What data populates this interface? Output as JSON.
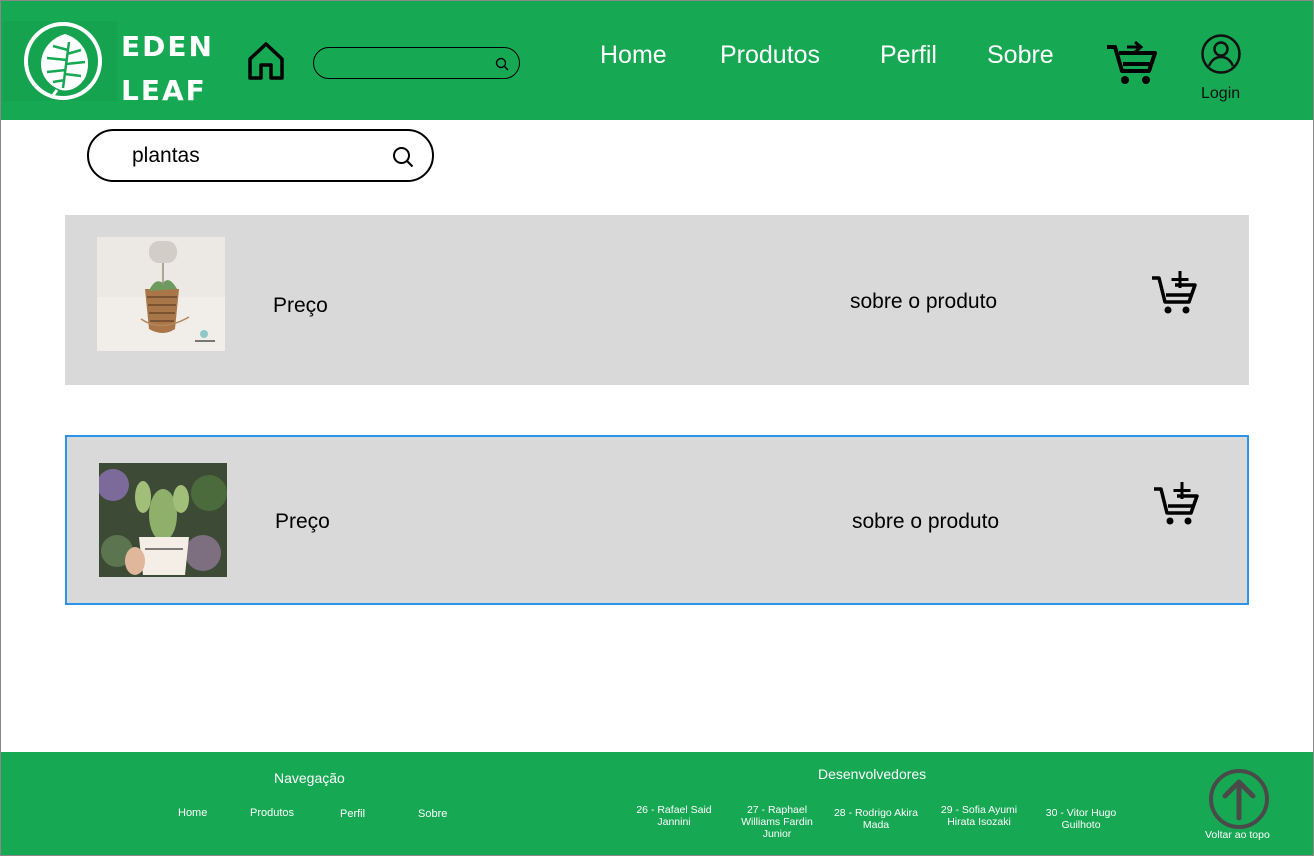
{
  "header": {
    "brand_line1": "EDEN",
    "brand_line2": "LEAF",
    "search_value": "",
    "nav": [
      "Home",
      "Produtos",
      "Perfil",
      "Sobre"
    ],
    "login_label": "Login"
  },
  "search": {
    "value": "plantas"
  },
  "products": [
    {
      "price_label": "Preço",
      "about_label": "sobre o produto",
      "image": "succulent-in-basket",
      "selected": false
    },
    {
      "price_label": "Preço",
      "about_label": "sobre o produto",
      "image": "cactus-in-pot",
      "selected": true
    }
  ],
  "footer": {
    "nav_title": "Navegação",
    "nav_links": [
      "Home",
      "Produtos",
      "Perfil",
      "Sobre"
    ],
    "devs_title": "Desenvolvedores",
    "devs": [
      [
        "26 - Rafael Said",
        "Jannini"
      ],
      [
        "27 - Raphael",
        "Williams Fardin",
        "Junior"
      ],
      [
        "28 - Rodrigo Akira",
        "Mada"
      ],
      [
        "29 - Sofia Ayumi",
        "Hirata Isozaki"
      ],
      [
        "30 - Vitor Hugo",
        "Guilhoto"
      ]
    ],
    "back_to_top": "Voltar ao topo"
  },
  "colors": {
    "brand_green": "#17a853",
    "row_gray": "#d9d9d9",
    "selection_blue": "#2b95e8"
  },
  "icons": [
    "leaf-logo-icon",
    "home-icon",
    "search-icon",
    "cart-add-icon",
    "user-icon",
    "arrow-up-icon"
  ]
}
